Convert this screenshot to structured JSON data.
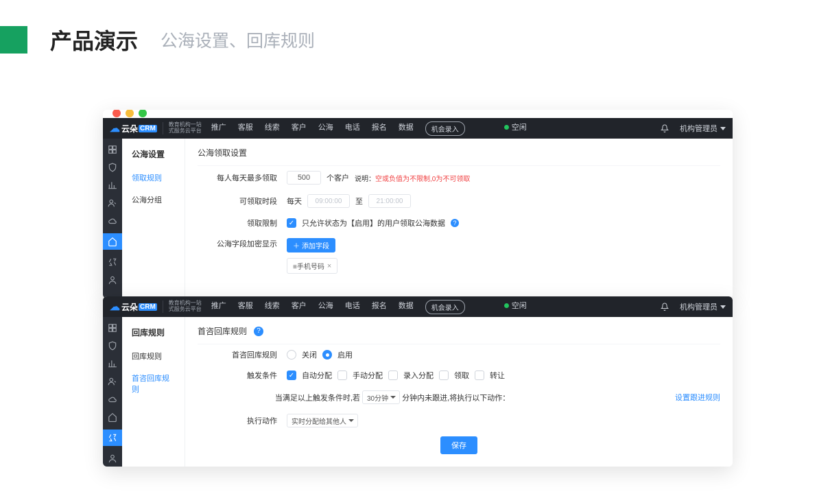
{
  "slide": {
    "title_main": "产品演示",
    "title_sub": "公海设置、回库规则"
  },
  "common": {
    "logo_cloud": "云朵",
    "logo_crm": "CRM",
    "logo_sub1": "教育机构一站",
    "logo_sub2": "式服务云平台",
    "nav": {
      "promo": "推广",
      "service": "客服",
      "leads": "线索",
      "customer": "客户",
      "sea": "公海",
      "phone": "电话",
      "signup": "报名",
      "data": "数据",
      "entry": "机会录入",
      "status": "空闲",
      "role": "机构管理员"
    }
  },
  "s1": {
    "side_title": "公海设置",
    "side_items": [
      "领取规则",
      "公海分组"
    ],
    "section": "公海领取设置",
    "r1_label": "每人每天最多领取",
    "r1_value": "500",
    "r1_unit": "个客户",
    "r1_hint_lbl": "说明：",
    "r1_hint": "空或负值为不限制,0为不可领取",
    "r2_label": "可领取时段",
    "r2_daily": "每天",
    "r2_from": "09:00:00",
    "r2_to_lbl": "至",
    "r2_to": "21:00:00",
    "r3_label": "领取限制",
    "r3_text": "只允许状态为【启用】的用户领取公海数据",
    "r4_label": "公海字段加密显示",
    "r4_btn": "添加字段",
    "r4_chip": "≡手机号码"
  },
  "s2": {
    "side_title": "回库规则",
    "side_items": [
      "回库规则",
      "首咨回库规则"
    ],
    "section": "首咨回库规则",
    "r1_label": "首咨回库规则",
    "r1_off": "关闭",
    "r1_on": "启用",
    "r2_label": "触发条件",
    "r2_opts": [
      "自动分配",
      "手动分配",
      "录入分配",
      "领取",
      "转让"
    ],
    "r3_pre": "当满足以上触发条件时,若",
    "r3_sel": "30分钟",
    "r3_post": "分钟内未跟进,将执行以下动作：",
    "r3_link": "设置跟进规则",
    "r4_label": "执行动作",
    "r4_sel": "实时分配给其他人",
    "save": "保存"
  }
}
